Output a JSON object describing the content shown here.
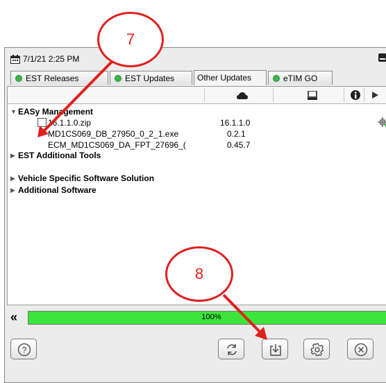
{
  "header": {
    "datetime": "7/1/21 2:25 PM"
  },
  "tabs": [
    {
      "label": "EST Releases"
    },
    {
      "label": "EST Updates"
    },
    {
      "label": "Other Updates"
    },
    {
      "label": "eTIM GO"
    }
  ],
  "tree": {
    "group1": "EASy Management",
    "items": [
      {
        "name": "16.1.1.0.zip",
        "version": "16.1.1.0"
      },
      {
        "name": "MD1CS069_DB_27950_0_2_1.exe",
        "version": "0.2.1"
      },
      {
        "name": "ECM_MD1CS069_DA_FPT_27696_(",
        "version": "0.45.7"
      }
    ],
    "group2": "EST Additional Tools",
    "group3": "Vehicle Specific Software Solution",
    "group4": "Additional Software"
  },
  "progress": {
    "percent_label": "100%",
    "value": 1.0
  },
  "annotations": {
    "step7": "7",
    "step8": "8"
  },
  "colors": {
    "accent_green": "#3cb54a",
    "progress_green": "#3ce43c",
    "annotation_red": "#e0201e"
  }
}
